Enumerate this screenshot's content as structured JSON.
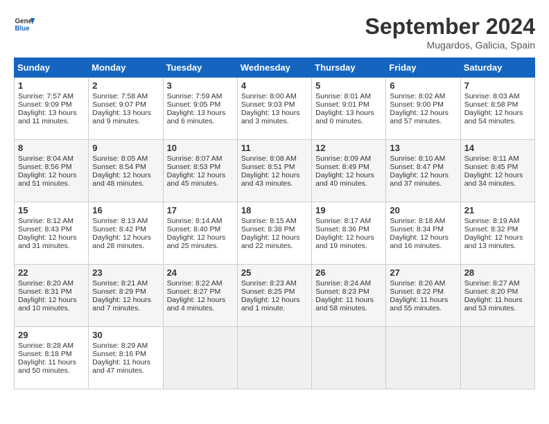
{
  "logo": {
    "line1": "General",
    "line2": "Blue"
  },
  "title": "September 2024",
  "location": "Mugardos, Galicia, Spain",
  "days_of_week": [
    "Sunday",
    "Monday",
    "Tuesday",
    "Wednesday",
    "Thursday",
    "Friday",
    "Saturday"
  ],
  "weeks": [
    [
      {
        "num": "1",
        "rise": "7:57 AM",
        "set": "9:09 PM",
        "daylight": "13 hours and 11 minutes."
      },
      {
        "num": "2",
        "rise": "7:58 AM",
        "set": "9:07 PM",
        "daylight": "13 hours and 9 minutes."
      },
      {
        "num": "3",
        "rise": "7:59 AM",
        "set": "9:05 PM",
        "daylight": "13 hours and 6 minutes."
      },
      {
        "num": "4",
        "rise": "8:00 AM",
        "set": "9:03 PM",
        "daylight": "13 hours and 3 minutes."
      },
      {
        "num": "5",
        "rise": "8:01 AM",
        "set": "9:01 PM",
        "daylight": "13 hours and 0 minutes."
      },
      {
        "num": "6",
        "rise": "8:02 AM",
        "set": "9:00 PM",
        "daylight": "12 hours and 57 minutes."
      },
      {
        "num": "7",
        "rise": "8:03 AM",
        "set": "8:58 PM",
        "daylight": "12 hours and 54 minutes."
      }
    ],
    [
      {
        "num": "8",
        "rise": "8:04 AM",
        "set": "8:56 PM",
        "daylight": "12 hours and 51 minutes."
      },
      {
        "num": "9",
        "rise": "8:05 AM",
        "set": "8:54 PM",
        "daylight": "12 hours and 48 minutes."
      },
      {
        "num": "10",
        "rise": "8:07 AM",
        "set": "8:53 PM",
        "daylight": "12 hours and 45 minutes."
      },
      {
        "num": "11",
        "rise": "8:08 AM",
        "set": "8:51 PM",
        "daylight": "12 hours and 43 minutes."
      },
      {
        "num": "12",
        "rise": "8:09 AM",
        "set": "8:49 PM",
        "daylight": "12 hours and 40 minutes."
      },
      {
        "num": "13",
        "rise": "8:10 AM",
        "set": "8:47 PM",
        "daylight": "12 hours and 37 minutes."
      },
      {
        "num": "14",
        "rise": "8:11 AM",
        "set": "8:45 PM",
        "daylight": "12 hours and 34 minutes."
      }
    ],
    [
      {
        "num": "15",
        "rise": "8:12 AM",
        "set": "8:43 PM",
        "daylight": "12 hours and 31 minutes."
      },
      {
        "num": "16",
        "rise": "8:13 AM",
        "set": "8:42 PM",
        "daylight": "12 hours and 28 minutes."
      },
      {
        "num": "17",
        "rise": "8:14 AM",
        "set": "8:40 PM",
        "daylight": "12 hours and 25 minutes."
      },
      {
        "num": "18",
        "rise": "8:15 AM",
        "set": "8:38 PM",
        "daylight": "12 hours and 22 minutes."
      },
      {
        "num": "19",
        "rise": "8:17 AM",
        "set": "8:36 PM",
        "daylight": "12 hours and 19 minutes."
      },
      {
        "num": "20",
        "rise": "8:18 AM",
        "set": "8:34 PM",
        "daylight": "12 hours and 16 minutes."
      },
      {
        "num": "21",
        "rise": "8:19 AM",
        "set": "8:32 PM",
        "daylight": "12 hours and 13 minutes."
      }
    ],
    [
      {
        "num": "22",
        "rise": "8:20 AM",
        "set": "8:31 PM",
        "daylight": "12 hours and 10 minutes."
      },
      {
        "num": "23",
        "rise": "8:21 AM",
        "set": "8:29 PM",
        "daylight": "12 hours and 7 minutes."
      },
      {
        "num": "24",
        "rise": "8:22 AM",
        "set": "8:27 PM",
        "daylight": "12 hours and 4 minutes."
      },
      {
        "num": "25",
        "rise": "8:23 AM",
        "set": "8:25 PM",
        "daylight": "12 hours and 1 minute."
      },
      {
        "num": "26",
        "rise": "8:24 AM",
        "set": "8:23 PM",
        "daylight": "11 hours and 58 minutes."
      },
      {
        "num": "27",
        "rise": "8:26 AM",
        "set": "8:22 PM",
        "daylight": "11 hours and 55 minutes."
      },
      {
        "num": "28",
        "rise": "8:27 AM",
        "set": "8:20 PM",
        "daylight": "11 hours and 53 minutes."
      }
    ],
    [
      {
        "num": "29",
        "rise": "8:28 AM",
        "set": "8:18 PM",
        "daylight": "11 hours and 50 minutes."
      },
      {
        "num": "30",
        "rise": "8:29 AM",
        "set": "8:16 PM",
        "daylight": "11 hours and 47 minutes."
      },
      null,
      null,
      null,
      null,
      null
    ]
  ]
}
